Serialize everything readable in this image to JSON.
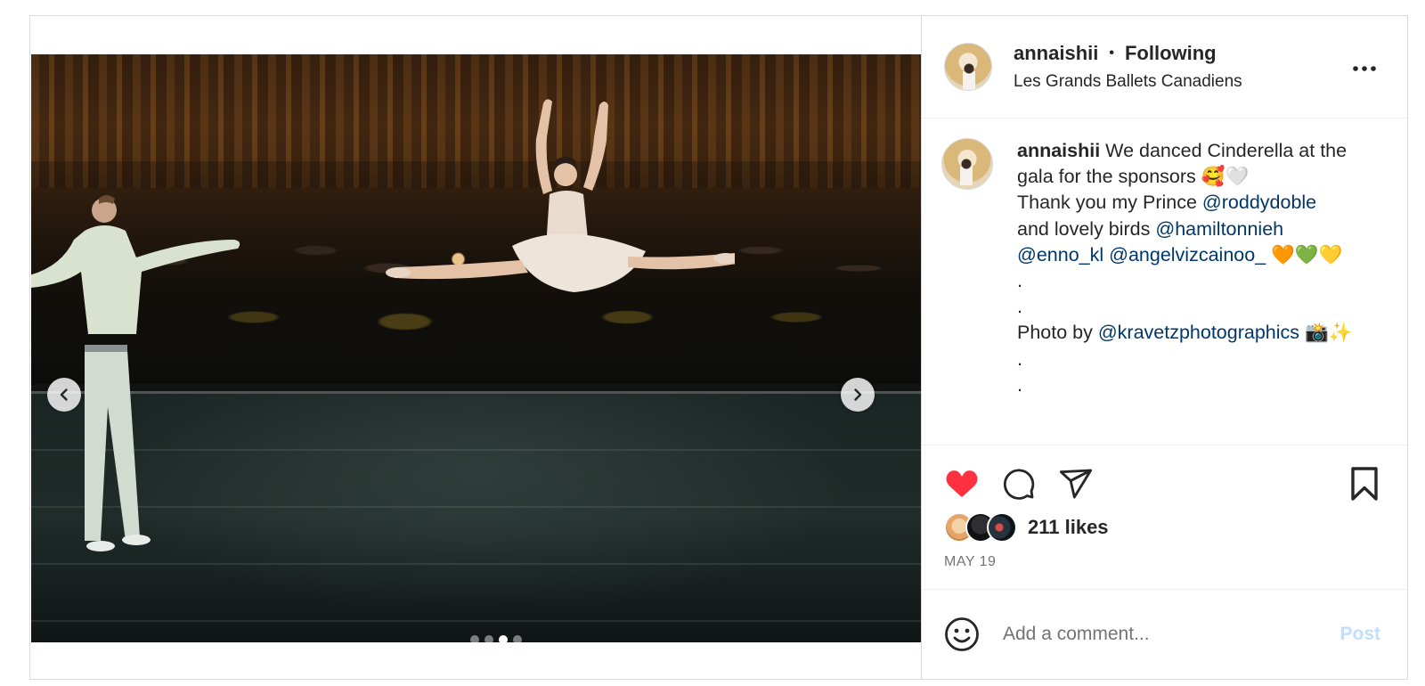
{
  "header": {
    "username": "annaishii",
    "separator": "•",
    "follow_status": "Following",
    "location": "Les Grands Ballets Canadiens"
  },
  "media": {
    "image_description_icon": "photo-carousel",
    "carousel_total": 4,
    "carousel_active_index": 2
  },
  "caption": {
    "username": "annaishii",
    "line1_text": " We danced Cinderella at the gala for the sponsors 🥰🤍",
    "line2_text": "Thank you my Prince ",
    "mention_prince": "@roddydoble",
    "line3_text": "and lovely birds ",
    "mention_bird1": "@hamiltonnieh",
    "mention_bird2": "@enno_kl",
    "mention_bird3": "@angelvizcainoo_",
    "hearts": " 🧡💚💛",
    "dot1": ".",
    "dot2": ".",
    "photo_by": "Photo by ",
    "mention_photo": "@kravetzphotographics",
    "photo_emoji": " 📸✨",
    "dot3": ".",
    "dot4": "."
  },
  "actions": {
    "like_icon": "heart-filled-icon",
    "like_color": "#ff3040",
    "comment_icon": "comment-icon",
    "share_icon": "paper-plane-icon",
    "save_icon": "bookmark-icon"
  },
  "likes": {
    "label": "211 likes"
  },
  "date": "MAY 19",
  "comment": {
    "placeholder": "Add a comment...",
    "post_label": "Post",
    "post_color": "#c0dffd",
    "emoji_icon": "smiley-icon"
  }
}
